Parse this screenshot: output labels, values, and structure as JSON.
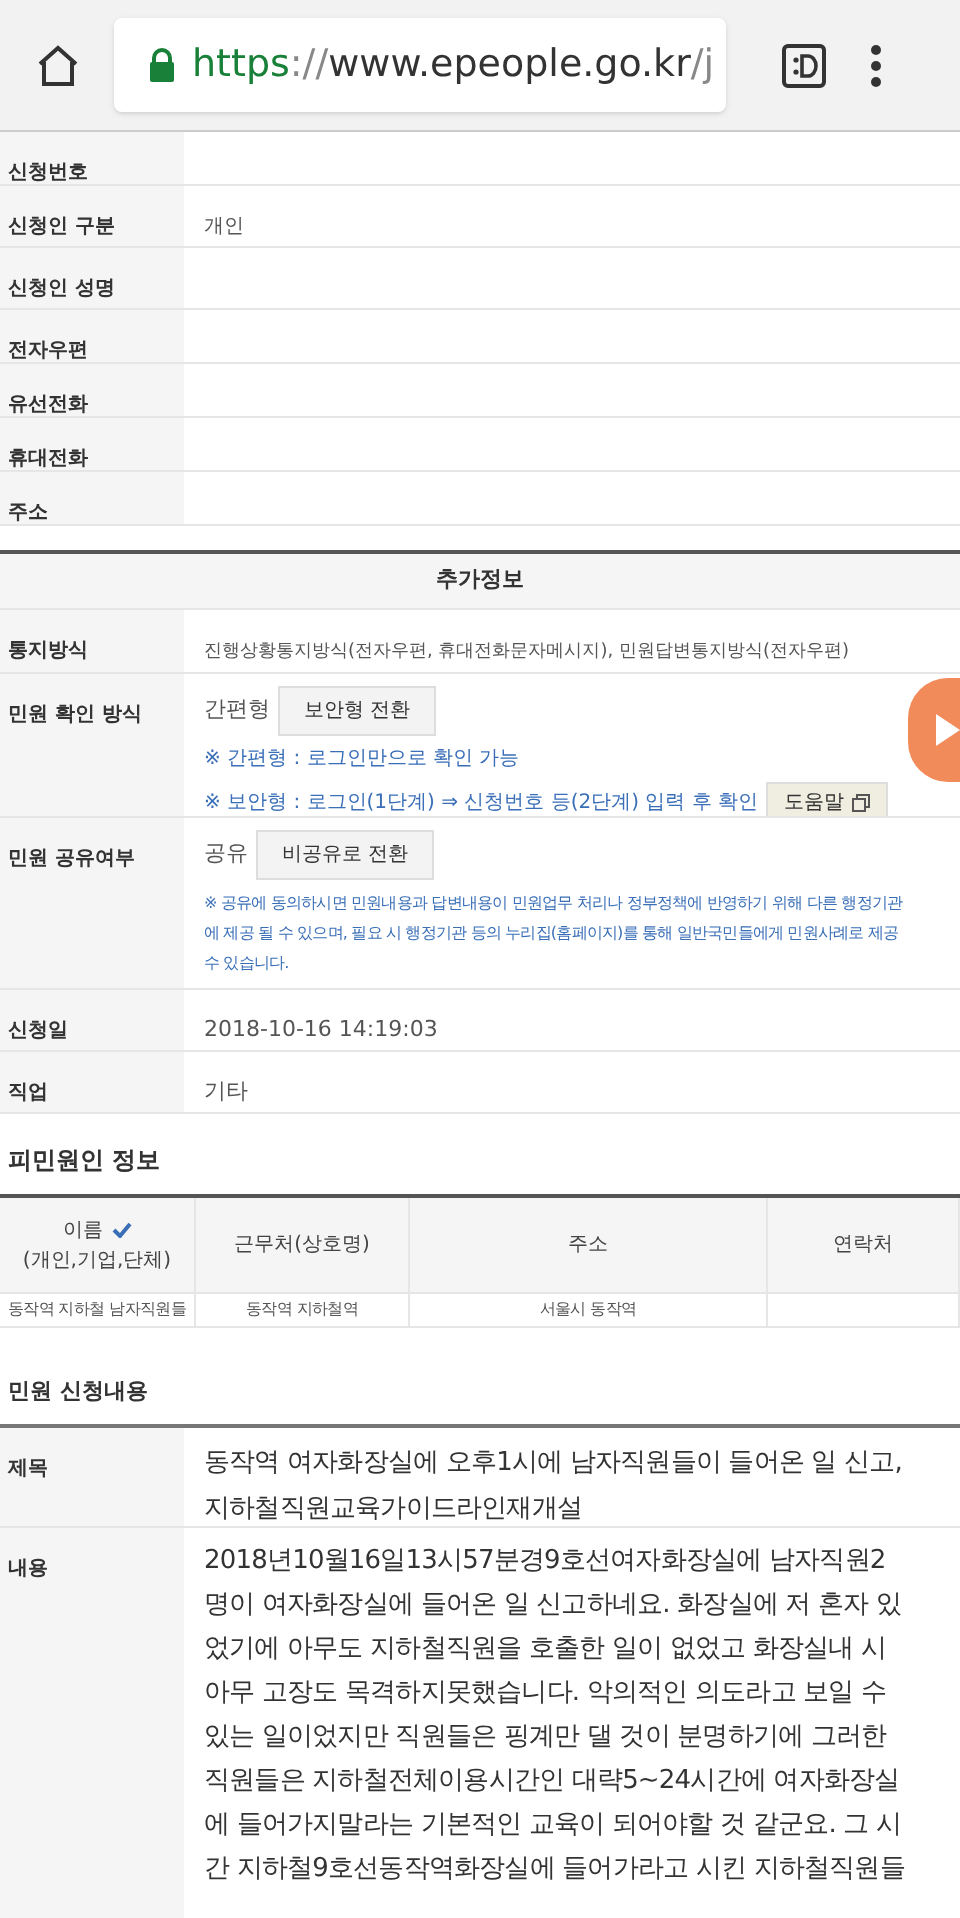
{
  "browser": {
    "url_host": "https://www.epeople.go.kr/",
    "url_rest": "j"
  },
  "applicant": [
    {
      "label": "신청번호"
    },
    {
      "label": "신청인 구분",
      "value": "개인"
    },
    {
      "label": "신청인 성명"
    },
    {
      "label": "전자우편"
    },
    {
      "label": "유선전화"
    },
    {
      "label": "휴대전화"
    },
    {
      "label": "주소"
    }
  ],
  "extra": {
    "title": "추가정보",
    "notify": {
      "label": "통지방식",
      "value": "진행상황통지방식(전자우편, 휴대전화문자메시지), 민원답변통지방식(전자우편)"
    },
    "confirm": {
      "label": "민원 확인 방식",
      "value": "간편형",
      "button": "보안형 전환",
      "notes": [
        "※ 간편형 : 로그인만으로 확인 가능",
        "※ 보안형 : 로그인(1단계) ⇒ 신청번호 등(2단계) 입력 후 확인"
      ],
      "help": "도움말"
    },
    "share": {
      "label": "민원 공유여부",
      "value": "공유",
      "button": "비공유로 전환",
      "notes": [
        "※ 공유에 동의하시면 민원내용과 답변내용이 민원업무 처리나 정부정책에 반영하기 위해 다른 행정기관",
        "에 제공 될 수 있으며, 필요 시 행정기관 등의 누리집(홈페이지)를 통해 일반국민들에게 민원사례로 제공",
        "수 있습니다."
      ]
    },
    "date": {
      "label": "신청일",
      "value": "2018-10-16 14:19:03"
    },
    "job": {
      "label": "직업",
      "value": "기타"
    }
  },
  "respondent": {
    "title": "피민원인 정보",
    "columns": [
      {
        "label": "이름",
        "sub": "(개인,기업,단체)",
        "verified": true
      },
      {
        "label": "근무처(상호명)"
      },
      {
        "label": "주소"
      },
      {
        "label": "연락처"
      }
    ],
    "row": [
      "동작역 지하철 남자직원들",
      "동작역 지하철역",
      "서울시 동작역"
    ]
  },
  "complaint": {
    "title": "민원 신청내용",
    "subject_label": "제목",
    "subject": [
      "동작역 여자화장실에 오후1시에 남자직원들이 들어온 일 신고,",
      "지하철직원교육가이드라인재개설"
    ],
    "body_label": "내용",
    "body": [
      "2018년10월16일13시57분경9호선여자화장실에 남자직원2",
      "명이 여자화장실에 들어온 일 신고하네요. 화장실에 저 혼자 있",
      "었기에 아무도 지하철직원을 호출한 일이 없었고 화장실내 시",
      "아무 고장도 목격하지못했습니다. 악의적인 의도라고 보일 수",
      "있는 일이었지만 직원들은 핑계만 댈 것이 분명하기에 그러한",
      "직원들은 지하철전체이용시간인 대략5~24시간에 여자화장실",
      "에 들어가지말라는 기본적인 교육이 되어야할 것 같군요. 그 시",
      "간 지하철9호선동작역화장실에 들어가라고 시킨 지하철직원들"
    ]
  }
}
